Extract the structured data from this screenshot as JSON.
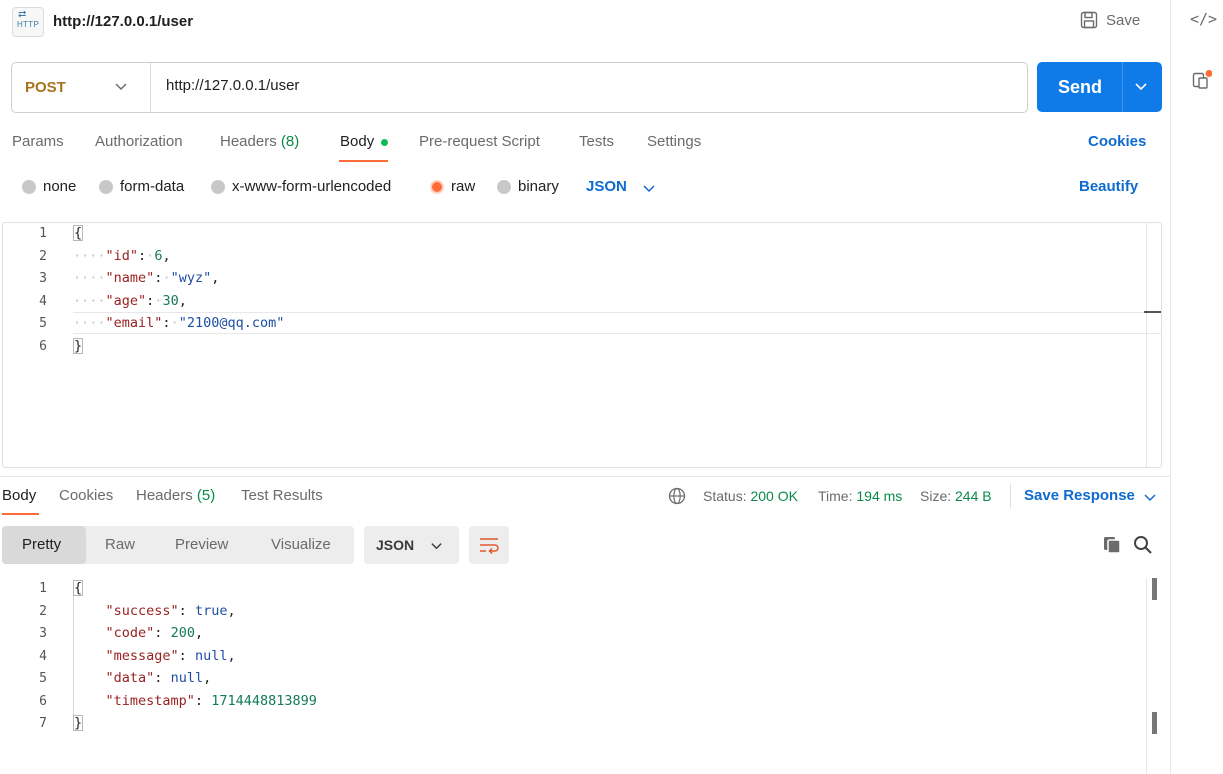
{
  "header": {
    "title": "http://127.0.0.1/user",
    "save_label": "Save",
    "http_badge": "HTTP"
  },
  "request": {
    "method": "POST",
    "url": "http://127.0.0.1/user",
    "send_label": "Send"
  },
  "tabs": {
    "params": "Params",
    "authorization": "Authorization",
    "headers": "Headers",
    "headers_count": "(8)",
    "body": "Body",
    "prerequest": "Pre-request Script",
    "tests": "Tests",
    "settings": "Settings",
    "cookies": "Cookies"
  },
  "body_types": {
    "none": "none",
    "form_data": "form-data",
    "urlencoded": "x-www-form-urlencoded",
    "raw": "raw",
    "binary": "binary",
    "format": "JSON",
    "beautify": "Beautify"
  },
  "request_body": {
    "line_numbers": [
      "1",
      "2",
      "3",
      "4",
      "5",
      "6"
    ],
    "lines": [
      {
        "key": "\"id\"",
        "value": "6",
        "value_type": "number",
        "comma": ","
      },
      {
        "key": "\"name\"",
        "value": "\"wyz\"",
        "value_type": "string",
        "comma": ","
      },
      {
        "key": "\"age\"",
        "value": "30",
        "value_type": "number",
        "comma": ","
      },
      {
        "key": "\"email\"",
        "value": "\"2100@qq.com\"",
        "value_type": "string",
        "comma": ""
      }
    ],
    "open_brace": "{",
    "close_brace": "}"
  },
  "response_tabs": {
    "body": "Body",
    "cookies": "Cookies",
    "headers": "Headers",
    "headers_count": "(5)",
    "test_results": "Test Results"
  },
  "response_status": {
    "status_label": "Status:",
    "status_value": "200 OK",
    "time_label": "Time:",
    "time_value": "194 ms",
    "size_label": "Size:",
    "size_value": "244 B",
    "save_response": "Save Response"
  },
  "response_view": {
    "pretty": "Pretty",
    "raw": "Raw",
    "preview": "Preview",
    "visualize": "Visualize",
    "format": "JSON"
  },
  "response_body": {
    "line_numbers": [
      "1",
      "2",
      "3",
      "4",
      "5",
      "6",
      "7"
    ],
    "lines": [
      {
        "key": "\"success\"",
        "value": "true",
        "value_type": "bool",
        "comma": ","
      },
      {
        "key": "\"code\"",
        "value": "200",
        "value_type": "number",
        "comma": ","
      },
      {
        "key": "\"message\"",
        "value": "null",
        "value_type": "bool",
        "comma": ","
      },
      {
        "key": "\"data\"",
        "value": "null",
        "value_type": "bool",
        "comma": ","
      },
      {
        "key": "\"timestamp\"",
        "value": "1714448813899",
        "value_type": "number",
        "comma": ""
      }
    ],
    "open_brace": "{",
    "close_brace": "}"
  },
  "colors": {
    "accent": "#ff6c37",
    "send": "#0f7be8",
    "link": "#0f6bd0",
    "success": "#0a8a4a",
    "method": "#a8731a"
  }
}
